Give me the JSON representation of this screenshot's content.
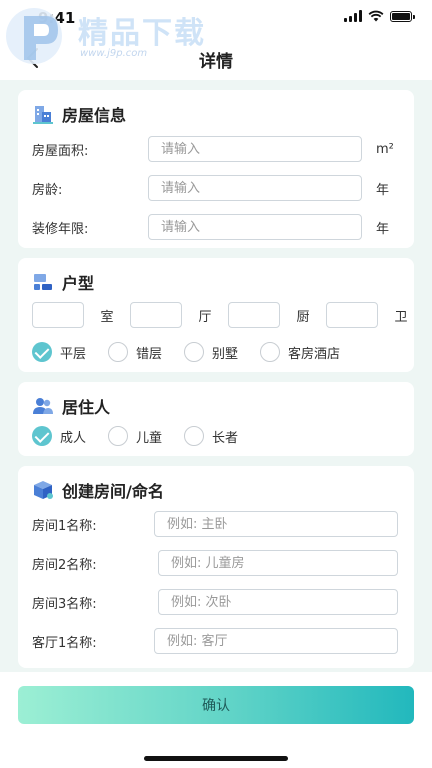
{
  "status": {
    "time": "9:41"
  },
  "watermark": {
    "title": "精品下载",
    "url": "www.j9p.com"
  },
  "nav": {
    "title": "详情"
  },
  "house_info": {
    "title": "房屋信息",
    "fields": [
      {
        "label": "房屋面积:",
        "placeholder": "请输入",
        "unit": "m²"
      },
      {
        "label": "房龄:",
        "placeholder": "请输入",
        "unit": "年"
      },
      {
        "label": "装修年限:",
        "placeholder": "请输入",
        "unit": "年"
      }
    ]
  },
  "layout": {
    "title": "户型",
    "units": [
      "室",
      "厅",
      "厨",
      "卫"
    ],
    "options": [
      {
        "label": "平层",
        "checked": true
      },
      {
        "label": "错层",
        "checked": false
      },
      {
        "label": "别墅",
        "checked": false
      },
      {
        "label": "客房酒店",
        "checked": false
      }
    ]
  },
  "residents": {
    "title": "居住人",
    "options": [
      {
        "label": "成人",
        "checked": true
      },
      {
        "label": "儿童",
        "checked": false
      },
      {
        "label": "长者",
        "checked": false
      }
    ]
  },
  "rooms": {
    "title": "创建房间/命名",
    "fields": [
      {
        "label": "房间1名称:",
        "placeholder": "例如: 主卧"
      },
      {
        "label": "房间2名称:",
        "placeholder": "例如: 儿童房"
      },
      {
        "label": "房间3名称:",
        "placeholder": "例如: 次卧"
      },
      {
        "label": "客厅1名称:",
        "placeholder": "例如: 客厅"
      }
    ]
  },
  "confirm": {
    "label": "确认"
  },
  "colors": {
    "accent": "#5ec5cf",
    "background": "#eef6f4",
    "button_start": "#9cefd4",
    "button_end": "#22b8bd"
  }
}
